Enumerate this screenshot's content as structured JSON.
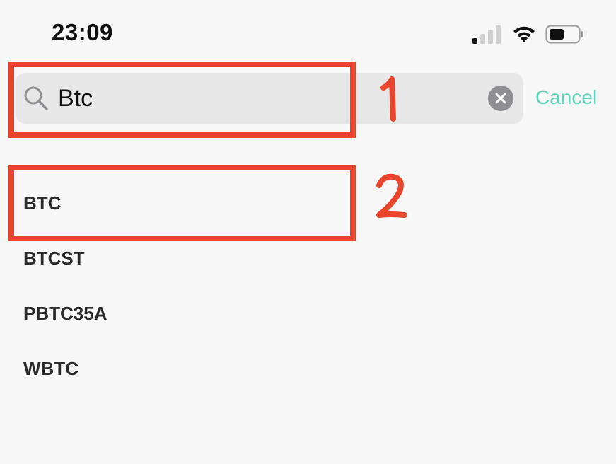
{
  "status_bar": {
    "time": "23:09",
    "signal_icon": "cellular-signal-icon",
    "wifi_icon": "wifi-icon",
    "battery_icon": "battery-icon",
    "battery_level": 0.5,
    "signal_bars_active": 1
  },
  "search": {
    "value": "Btc",
    "search_icon": "search-icon",
    "clear_icon": "clear-x-icon",
    "cancel_label": "Cancel"
  },
  "results": [
    {
      "label": "BTC"
    },
    {
      "label": "BTCST"
    },
    {
      "label": "PBTC35A"
    },
    {
      "label": "WBTC"
    }
  ],
  "annotations": [
    {
      "number": "1"
    },
    {
      "number": "2"
    }
  ],
  "colors": {
    "accent": "#5fd3bb",
    "annotation_red": "#e8452c",
    "background": "#f7f7f7",
    "search_field": "#e7e7e8"
  }
}
